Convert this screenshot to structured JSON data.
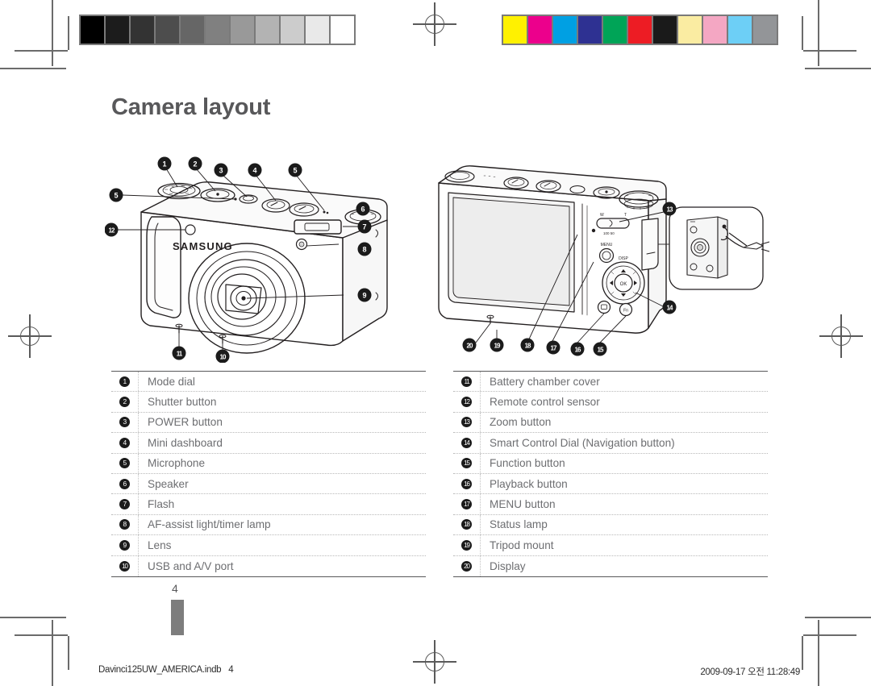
{
  "page": {
    "title": "Camera layout",
    "page_number": "4",
    "footer_left_file": "Davinci125UW_AMERICA.indb",
    "footer_left_page": "4",
    "footer_right": "2009-09-17   오전 11:28:49"
  },
  "calibration": {
    "grayscale_label": "grayscale-step-wedge",
    "grayscale_swatches": [
      "#000000",
      "#1c1c1c",
      "#333333",
      "#4d4d4d",
      "#666666",
      "#808080",
      "#999999",
      "#b3b3b3",
      "#cccccc",
      "#e9e9e9",
      "#ffffff"
    ],
    "color_label": "color-control-patches",
    "color_swatches": [
      "#fff100",
      "#ec008c",
      "#00a0e3",
      "#2e3192",
      "#00a457",
      "#ed1c24",
      "#1a1a1a",
      "#faeca2",
      "#f4a7c3",
      "#6dcff6",
      "#939598"
    ]
  },
  "figures": {
    "front": {
      "name": "camera-front-view",
      "brand": "SAMSUNG",
      "callouts": [
        "1",
        "2",
        "3",
        "4",
        "5",
        "5",
        "6",
        "7",
        "8",
        "9",
        "10",
        "11",
        "12"
      ]
    },
    "rear": {
      "name": "camera-rear-view",
      "menu_label": "MENU",
      "ok_label": "OK",
      "disp_label": "DISP",
      "callouts": [
        "13",
        "14",
        "15",
        "16",
        "17",
        "18",
        "19",
        "20"
      ],
      "inset_name": "tripod-mount-strap-detail"
    }
  },
  "legend_left": [
    {
      "num": "1",
      "label": "Mode dial"
    },
    {
      "num": "2",
      "label": "Shutter button"
    },
    {
      "num": "3",
      "label": "POWER button"
    },
    {
      "num": "4",
      "label": "Mini dashboard"
    },
    {
      "num": "5",
      "label": "Microphone"
    },
    {
      "num": "6",
      "label": "Speaker"
    },
    {
      "num": "7",
      "label": "Flash"
    },
    {
      "num": "8",
      "label": "AF-assist light/timer lamp"
    },
    {
      "num": "9",
      "label": "Lens"
    },
    {
      "num": "10",
      "label": "USB and A/V port"
    }
  ],
  "legend_right": [
    {
      "num": "11",
      "label": "Battery chamber cover"
    },
    {
      "num": "12",
      "label": "Remote control sensor"
    },
    {
      "num": "13",
      "label": "Zoom button"
    },
    {
      "num": "14",
      "label": "Smart Control Dial (Navigation button)"
    },
    {
      "num": "15",
      "label": "Function button"
    },
    {
      "num": "16",
      "label": "Playback button"
    },
    {
      "num": "17",
      "label": "MENU button"
    },
    {
      "num": "18",
      "label": "Status lamp"
    },
    {
      "num": "19",
      "label": "Tripod mount"
    },
    {
      "num": "20",
      "label": "Display"
    }
  ],
  "colors": {
    "title": "#58585a",
    "body_text": "#6d6e71",
    "rule": "#58585a",
    "callout_fill": "#1b1b1b"
  }
}
